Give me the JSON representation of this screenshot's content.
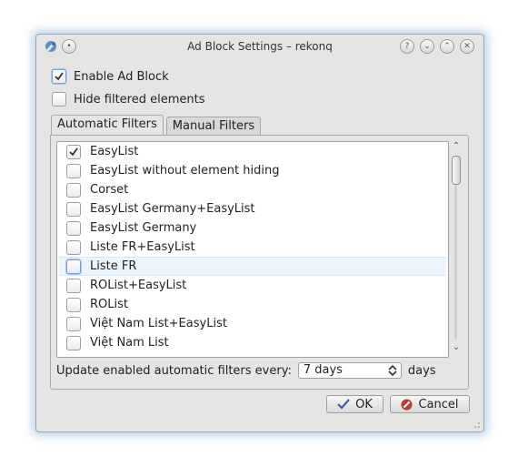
{
  "window": {
    "title": "Ad Block Settings – rekonq",
    "title_buttons": [
      "help-icon",
      "minimize-icon",
      "maximize-icon",
      "close-icon"
    ]
  },
  "options": {
    "enable_adblock": {
      "label": "Enable Ad Block",
      "checked": true
    },
    "hide_filtered": {
      "label": "Hide filtered elements",
      "checked": false
    }
  },
  "tabs": [
    {
      "label": "Automatic Filters",
      "active": true
    },
    {
      "label": "Manual Filters",
      "active": false
    }
  ],
  "filters": [
    {
      "label": "EasyList",
      "checked": true
    },
    {
      "label": "EasyList without element hiding",
      "checked": false
    },
    {
      "label": "Corset",
      "checked": false
    },
    {
      "label": "EasyList Germany+EasyList",
      "checked": false
    },
    {
      "label": "EasyList Germany",
      "checked": false
    },
    {
      "label": "Liste FR+EasyList",
      "checked": false
    },
    {
      "label": "Liste FR",
      "checked": false,
      "hovered": true
    },
    {
      "label": "ROList+EasyList",
      "checked": false
    },
    {
      "label": "ROList",
      "checked": false
    },
    {
      "label": "Việt Nam List+EasyList",
      "checked": false
    },
    {
      "label": "Việt Nam List",
      "checked": false
    }
  ],
  "update": {
    "label": "Update enabled automatic filters every:",
    "value": "7 days",
    "suffix": "days"
  },
  "buttons": {
    "ok": "OK",
    "cancel": "Cancel"
  },
  "colors": {
    "dialog_bg": "#e6e5e3",
    "focus_glow": "#6fa0d8",
    "hover_row": "#eef4fb"
  }
}
